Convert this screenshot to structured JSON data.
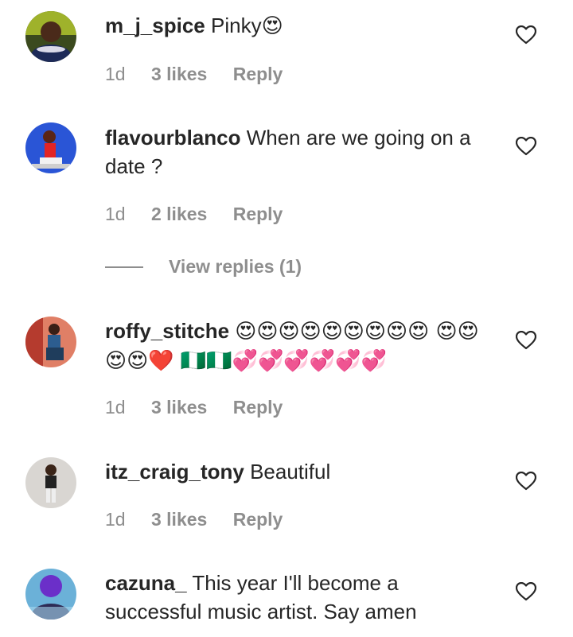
{
  "comments": [
    {
      "username": "m_j_spice",
      "text": "Pinky😍",
      "time": "1d",
      "likes": "3 likes",
      "reply": "Reply",
      "avatar_color": "#3b4a1e"
    },
    {
      "username": "flavourblanco",
      "text": "When are we going on a date ?",
      "time": "1d",
      "likes": "2 likes",
      "reply": "Reply",
      "view_replies": "View replies (1)",
      "avatar_color": "#2a55d6"
    },
    {
      "username": "roffy_stitche",
      "text": "😍😍😍😍😍😍😍😍😍 😍😍😍😍❤️ 🇳🇬🇳🇬💞💞💞💞💞💞",
      "time": "1d",
      "likes": "3 likes",
      "reply": "Reply",
      "avatar_color": "#e07f66"
    },
    {
      "username": "itz_craig_tony",
      "text": "Beautiful",
      "time": "1d",
      "likes": "3 likes",
      "reply": "Reply",
      "avatar_color": "#d9d6d2"
    },
    {
      "username": "cazuna_",
      "text": "This year I'll become a successful music artist. Say amen",
      "avatar_color": "#6bb1d8"
    }
  ],
  "icons": {
    "like": "heart-outline-icon"
  },
  "colors": {
    "meta_text": "#8e8e8e",
    "body_text": "#262626"
  }
}
